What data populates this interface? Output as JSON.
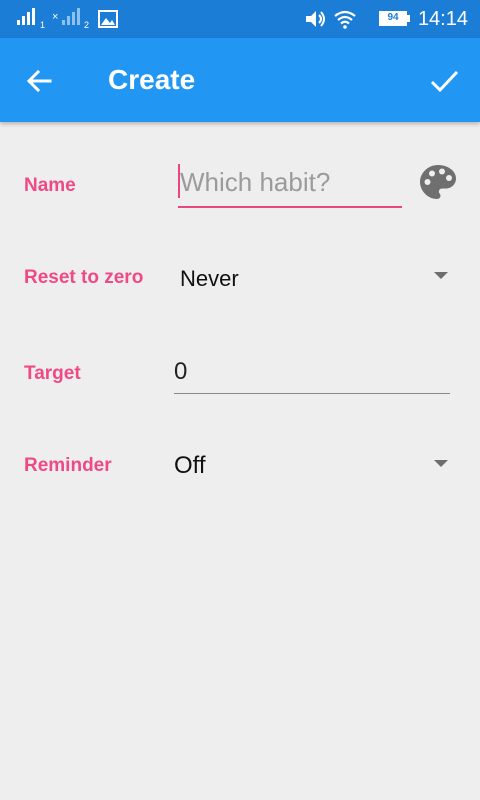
{
  "status_bar": {
    "sim1_label": "1",
    "sim2_label": "2",
    "battery_level": "94",
    "time": "14:14",
    "icons": [
      "signal-icon",
      "signal-x-icon",
      "image-icon",
      "volume-icon",
      "wifi-icon",
      "battery-icon"
    ]
  },
  "app_bar": {
    "title": "Create",
    "back_icon": "arrow-back-icon",
    "done_icon": "check-icon",
    "color": "#2196f3"
  },
  "form": {
    "accent_color": "#ee4a86",
    "name": {
      "label": "Name",
      "value": "",
      "placeholder": "Which habit?",
      "color_icon": "palette-icon"
    },
    "reset": {
      "label": "Reset to zero",
      "value": "Never"
    },
    "target": {
      "label": "Target",
      "value": "0"
    },
    "reminder": {
      "label": "Reminder",
      "value": "Off"
    }
  }
}
